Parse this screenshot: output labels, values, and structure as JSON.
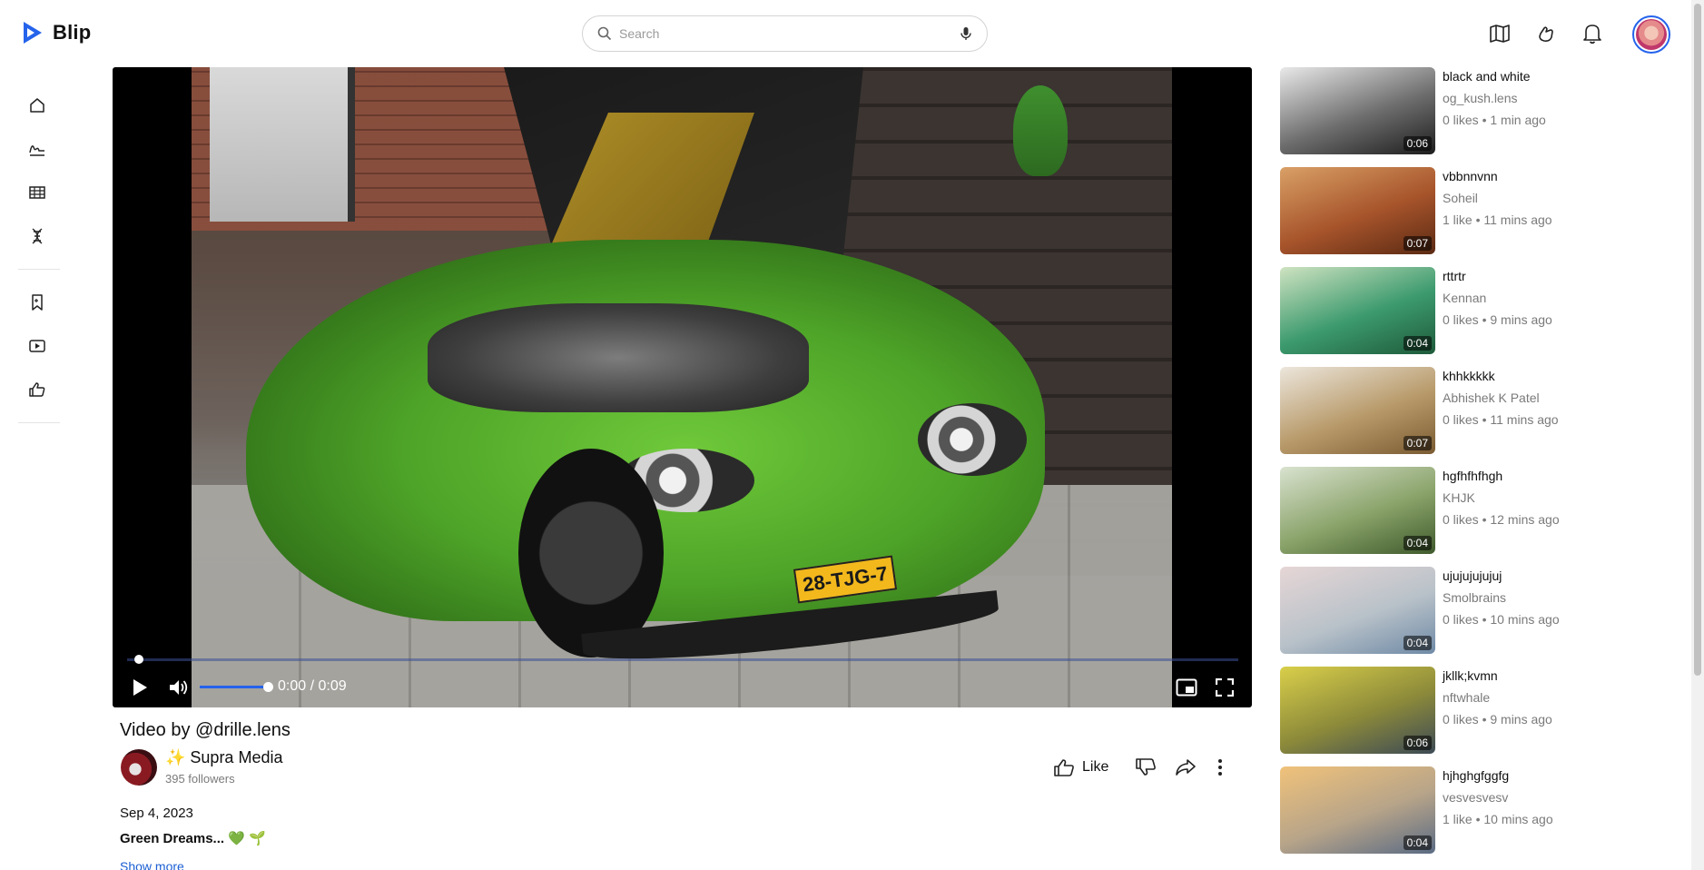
{
  "app": {
    "name": "Blip",
    "brand_color": "#2563eb"
  },
  "search": {
    "placeholder": "Search",
    "value": ""
  },
  "header": {
    "icons": [
      "map-icon",
      "hand-icon",
      "bell-icon",
      "avatar"
    ]
  },
  "rail": {
    "items": [
      "home-icon",
      "signature-icon",
      "film-icon",
      "dna-icon",
      "bookmark-icon",
      "video-library-icon",
      "thumbs-up-icon"
    ]
  },
  "player": {
    "time": "0:00 / 0:09",
    "progress_fraction": 0.0,
    "volume_fraction": 1.0,
    "plate_text": "28-TJG-7"
  },
  "video": {
    "title": "Video by @drille.lens",
    "channel": "✨ Supra Media",
    "followers": "395 followers",
    "date": "Sep 4, 2023",
    "description": "Green Dreams... 💚 🌱",
    "show_more": "Show more",
    "like_label": "Like"
  },
  "suggestions": [
    {
      "title": "black and white",
      "channel": "og_kush.lens",
      "meta": "0 likes  •  1 min ago",
      "duration": "0:06",
      "thumb_colors": [
        "#e9e9e9",
        "#6e6e6e",
        "#1d1d1d"
      ]
    },
    {
      "title": "vbbnnvnn",
      "channel": "Soheil",
      "meta": "1 like  •  11 mins ago",
      "duration": "0:07",
      "thumb_colors": [
        "#d9a066",
        "#a7542b",
        "#5b2a13"
      ]
    },
    {
      "title": "rttrtr",
      "channel": "Kennan",
      "meta": "0 likes  •  9 mins ago",
      "duration": "0:04",
      "thumb_colors": [
        "#cfe3c1",
        "#3c9a6e",
        "#1e5a3a"
      ]
    },
    {
      "title": "khhkkkkk",
      "channel": "Abhishek K Patel",
      "meta": "0 likes  •  11 mins ago",
      "duration": "0:07",
      "thumb_colors": [
        "#ece6dc",
        "#b89a6a",
        "#7a5b32"
      ]
    },
    {
      "title": "hgfhfhfhgh",
      "channel": "KHJK",
      "meta": "0 likes  •  12 mins ago",
      "duration": "0:04",
      "thumb_colors": [
        "#d9e2cf",
        "#8aa36a",
        "#3f5a2c"
      ]
    },
    {
      "title": "ujujujujujuj",
      "channel": "Smolbrains",
      "meta": "0 likes  •  10 mins ago",
      "duration": "0:04",
      "thumb_colors": [
        "#e6d6d6",
        "#b9c2c9",
        "#6f8aa6"
      ]
    },
    {
      "title": "jkllk;kvmn",
      "channel": "nftwhale",
      "meta": "0 likes  •  9 mins ago",
      "duration": "0:06",
      "thumb_colors": [
        "#d9cf4a",
        "#8c8a3a",
        "#3c4a55"
      ]
    },
    {
      "title": "hjhghgfggfg",
      "channel": "vesvesvesv",
      "meta": "1 like  •  10 mins ago",
      "duration": "0:04",
      "thumb_colors": [
        "#f0c27a",
        "#b7a489",
        "#5a6b84"
      ]
    }
  ]
}
